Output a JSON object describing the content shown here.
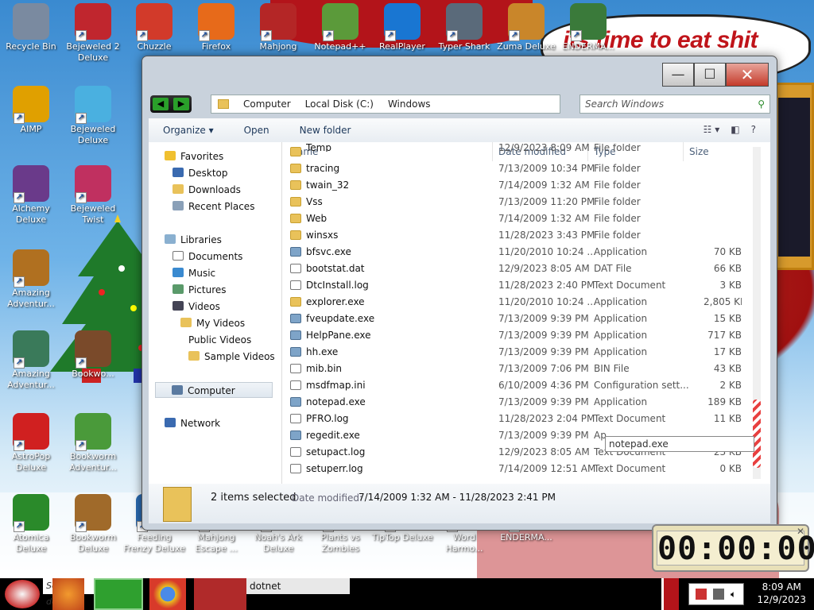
{
  "desktop": {
    "banner": "its time to eat shit",
    "icons": [
      {
        "label": "Recycle Bin",
        "icon": "recycle-bin-icon",
        "color": "#7a8aa0"
      },
      {
        "label": "Bejeweled 2 Deluxe",
        "icon": "bejeweled2-icon",
        "color": "#c0262e"
      },
      {
        "label": "Chuzzle",
        "icon": "chuzzle-icon",
        "color": "#d23a2a"
      },
      {
        "label": "Firefox",
        "icon": "firefox-icon",
        "color": "#e76a1a"
      },
      {
        "label": "Mahjong",
        "icon": "mahjong-icon",
        "color": "#b42626"
      },
      {
        "label": "Notepad++",
        "icon": "notepadpp-icon",
        "color": "#5b9a3a"
      },
      {
        "label": "RealPlayer",
        "icon": "realplayer-icon",
        "color": "#1976d2"
      },
      {
        "label": "Typer Shark",
        "icon": "typer-shark-icon",
        "color": "#5a6a7a"
      },
      {
        "label": "Zuma Deluxe",
        "icon": "zuma-icon",
        "color": "#c9862a"
      },
      {
        "label": "ENDERMA...",
        "icon": "enderma-icon",
        "color": "#3a7a3a"
      },
      {
        "label": "AIMP",
        "icon": "aimp-icon",
        "color": "#e0a000"
      },
      {
        "label": "Bejeweled Deluxe",
        "icon": "bejeweled-icon",
        "color": "#4ab0e0"
      },
      {
        "label": "Alchemy Deluxe",
        "icon": "alchemy-icon",
        "color": "#6a3a8a"
      },
      {
        "label": "Bejeweled Twist",
        "icon": "bejeweled-twist-icon",
        "color": "#c03060"
      },
      {
        "label": "Amazing Adventur...",
        "icon": "amazing-adventures-icon",
        "color": "#b07020"
      },
      {
        "label": "Amazing Adventur...",
        "icon": "amazing-adventures2-icon",
        "color": "#3a7a5a"
      },
      {
        "label": "Bookwo...",
        "icon": "bookworm-store-icon",
        "color": "#7a4a2a"
      },
      {
        "label": "AstroPop Deluxe",
        "icon": "astropop-icon",
        "color": "#d02020"
      },
      {
        "label": "Bookworm Adventur...",
        "icon": "bookworm-adventures-icon",
        "color": "#4a9a3a"
      },
      {
        "label": "Atomica Deluxe",
        "icon": "atomica-icon",
        "color": "#2a8a2a"
      },
      {
        "label": "Bookworm Deluxe",
        "icon": "bookworm-deluxe-icon",
        "color": "#a06a2a"
      },
      {
        "label": "Feeding Frenzy Deluxe",
        "icon": "feeding-frenzy-icon",
        "color": "#2a6ab0"
      },
      {
        "label": "Mahjong Escape ...",
        "icon": "mahjong-escape-icon",
        "color": "#8a3a2a"
      },
      {
        "label": "Noah's Ark Deluxe",
        "icon": "noahs-ark-icon",
        "color": "#6a8a3a"
      },
      {
        "label": "Plants vs Zombies",
        "icon": "pvz-icon",
        "color": "#4aa02a"
      },
      {
        "label": "TipTop Deluxe",
        "icon": "tiptop-icon",
        "color": "#2a5ab0"
      },
      {
        "label": "Word Harmo...",
        "icon": "word-harmony-icon",
        "color": "#b06a2a"
      },
      {
        "label": "ENDERMA...",
        "icon": "enderma2-icon",
        "color": "#3a3a3a"
      }
    ]
  },
  "window": {
    "controls": {
      "minimize": "—",
      "maximize": "☐",
      "close": "✕"
    },
    "breadcrumb": [
      "Computer",
      "Local Disk (C:)",
      "Windows"
    ],
    "search_placeholder": "Search Windows",
    "toolbar": {
      "organize": "Organize ▾",
      "open": "Open",
      "new_folder": "New folder"
    },
    "nav": {
      "favorites": "Favorites",
      "desktop": "Desktop",
      "downloads": "Downloads",
      "recent": "Recent Places",
      "libraries": "Libraries",
      "documents": "Documents",
      "music": "Music",
      "pictures": "Pictures",
      "videos": "Videos",
      "my_videos": "My Videos",
      "public_videos": "Public Videos",
      "sample_videos": "Sample Videos",
      "computer": "Computer",
      "network": "Network"
    },
    "columns": {
      "name": "Name",
      "date": "Date modified",
      "type": "Type",
      "size": "Size"
    },
    "files": [
      {
        "name": "Temp",
        "date": "12/9/2023 8:09 AM",
        "type": "File folder",
        "size": "",
        "kind": "fold"
      },
      {
        "name": "tracing",
        "date": "7/13/2009 10:34 PM",
        "type": "File folder",
        "size": "",
        "kind": "fold"
      },
      {
        "name": "twain_32",
        "date": "7/14/2009 1:32 AM",
        "type": "File folder",
        "size": "",
        "kind": "fold"
      },
      {
        "name": "Vss",
        "date": "7/13/2009 11:20 PM",
        "type": "File folder",
        "size": "",
        "kind": "fold"
      },
      {
        "name": "Web",
        "date": "7/14/2009 1:32 AM",
        "type": "File folder",
        "size": "",
        "kind": "fold"
      },
      {
        "name": "winsxs",
        "date": "11/28/2023 3:43 PM",
        "type": "File folder",
        "size": "",
        "kind": "fold"
      },
      {
        "name": "bfsvc.exe",
        "date": "11/20/2010 10:24 ...",
        "type": "Application",
        "size": "70 KB",
        "kind": "exe"
      },
      {
        "name": "bootstat.dat",
        "date": "12/9/2023 8:05 AM",
        "type": "DAT File",
        "size": "66 KB",
        "kind": "txt"
      },
      {
        "name": "DtcInstall.log",
        "date": "11/28/2023 2:40 PM",
        "type": "Text Document",
        "size": "3 KB",
        "kind": "txt"
      },
      {
        "name": "explorer.exe",
        "date": "11/20/2010 10:24 ...",
        "type": "Application",
        "size": "2,805 KB",
        "kind": "fold"
      },
      {
        "name": "fveupdate.exe",
        "date": "7/13/2009 9:39 PM",
        "type": "Application",
        "size": "15 KB",
        "kind": "exe"
      },
      {
        "name": "HelpPane.exe",
        "date": "7/13/2009 9:39 PM",
        "type": "Application",
        "size": "717 KB",
        "kind": "exe"
      },
      {
        "name": "hh.exe",
        "date": "7/13/2009 9:39 PM",
        "type": "Application",
        "size": "17 KB",
        "kind": "exe"
      },
      {
        "name": "mib.bin",
        "date": "7/13/2009 7:06 PM",
        "type": "BIN File",
        "size": "43 KB",
        "kind": "txt"
      },
      {
        "name": "msdfmap.ini",
        "date": "6/10/2009 4:36 PM",
        "type": "Configuration sett...",
        "size": "2 KB",
        "kind": "txt"
      },
      {
        "name": "notepad.exe",
        "date": "7/13/2009 9:39 PM",
        "type": "Application",
        "size": "189 KB",
        "kind": "exe"
      },
      {
        "name": "PFRO.log",
        "date": "11/28/2023 2:04 PM",
        "type": "Text Document",
        "size": "11 KB",
        "kind": "txt"
      },
      {
        "name": "regedit.exe",
        "date": "7/13/2009 9:39 PM",
        "type": "Ap",
        "size": "",
        "kind": "exe"
      },
      {
        "name": "setupact.log",
        "date": "12/9/2023 8:05 AM",
        "type": "Text Document",
        "size": "23 KB",
        "kind": "txt"
      },
      {
        "name": "setuperr.log",
        "date": "7/14/2009 12:51 AM",
        "type": "Text Document",
        "size": "0 KB",
        "kind": "txt"
      }
    ],
    "tooltip": "notepad.exe",
    "details": {
      "selection": "2 items selected",
      "date_label": "Date modified:",
      "date_value": "7/14/2009 1:32 AM - 11/28/2023 2:41 PM"
    }
  },
  "timer": {
    "value": "00:00:00"
  },
  "taskbar": {
    "search_text": "Search dotn",
    "active_label": "dotnet",
    "time": "8:09 AM",
    "date": "12/9/2023"
  }
}
